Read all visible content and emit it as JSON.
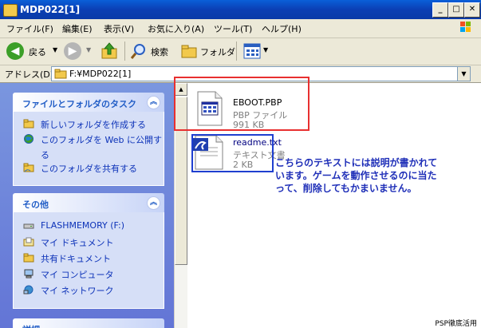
{
  "window": {
    "title": "MDP022[1]"
  },
  "menu": [
    "ファイル(F)",
    "編集(E)",
    "表示(V)",
    "お気に入り(A)",
    "ツール(T)",
    "ヘルプ(H)"
  ],
  "toolbar": {
    "back": "戻る",
    "search": "検索",
    "folders": "フォルダ"
  },
  "address": {
    "label": "アドレス(D)",
    "path": "F:¥MDP022[1]"
  },
  "tasks_panel": {
    "title": "ファイルとフォルダのタスク",
    "items": [
      "新しいフォルダを作成する",
      "このフォルダを Web に公開す",
      "る",
      "このフォルダを共有する"
    ]
  },
  "other_panel": {
    "title": "その他",
    "items": [
      "FLASHMEMORY (F:)",
      "マイ ドキュメント",
      "共有ドキュメント",
      "マイ コンピュータ",
      "マイ ネットワーク"
    ]
  },
  "third_panel": {
    "title": "詳細"
  },
  "files": [
    {
      "name": "EBOOT.PBP",
      "type": "PBP ファイル",
      "size": "991 KB"
    },
    {
      "name": "readme.txt",
      "type": "テキスト文書",
      "size": "2 KB"
    }
  ],
  "annotation": [
    "こちらのテキストには説明が書かれて",
    "います。ゲームを動作させるのに当た",
    "って、削除してもかまいません。"
  ],
  "credit": "PSP徹底活用",
  "colors": {
    "highlight_red": "#e83030",
    "highlight_blue": "#1f3fd0",
    "annotation_text": "#1f2fb8"
  }
}
